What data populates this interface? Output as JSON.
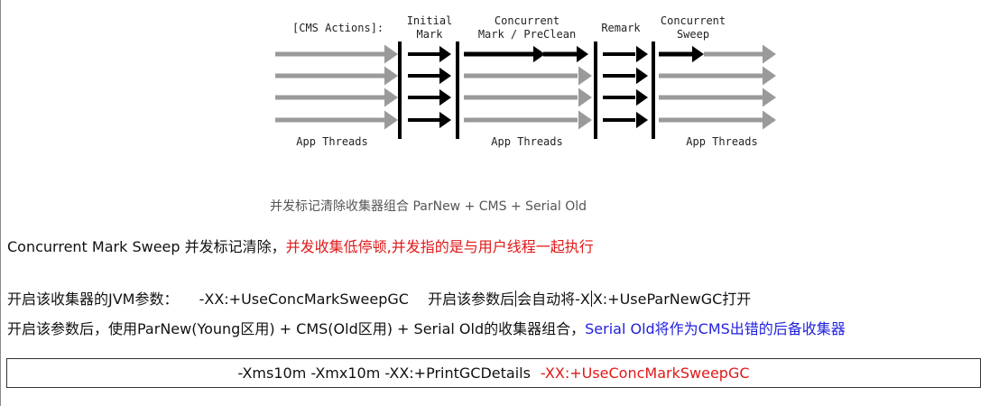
{
  "diagram": {
    "actions_label": "[CMS Actions]:",
    "phase_initial_mark": [
      "Initial",
      "Mark"
    ],
    "phase_concurrent_mark": [
      "Concurrent",
      "Mark / PreClean"
    ],
    "phase_remark": "Remark",
    "phase_concurrent_sweep": [
      "Concurrent",
      "Sweep"
    ],
    "app_threads_labels": [
      "App Threads",
      "App Threads",
      "App Threads"
    ],
    "colors": {
      "gray_arrow": "#9a9a9a",
      "black_arrow": "#000000"
    }
  },
  "caption": "并发标记清除收集器组合 ParNew + CMS + Serial Old",
  "line1": {
    "prefix": "Concurrent Mark Sweep 并发标记清除，",
    "red_text": "并发收集低停顿,并发指的是与用户线程一起执行"
  },
  "line2": {
    "label": "开启该收集器的JVM参数：",
    "param": "-XX:+UseConcMarkSweepGC",
    "note_a": "开启该参数后",
    "note_b": "会自动将-X",
    "note_c": "X:+UseParNewGC打开"
  },
  "line3": {
    "text": "开启该参数后，使用ParNew(Young区用) + CMS(Old区用) + Serial Old的收集器组合，",
    "blue_text": "Serial Old将作为CMS出错的后备收集器"
  },
  "command": {
    "plain": "-Xms10m -Xmx10m -XX:+PrintGCDetails",
    "red": "-XX:+UseConcMarkSweepGC"
  }
}
